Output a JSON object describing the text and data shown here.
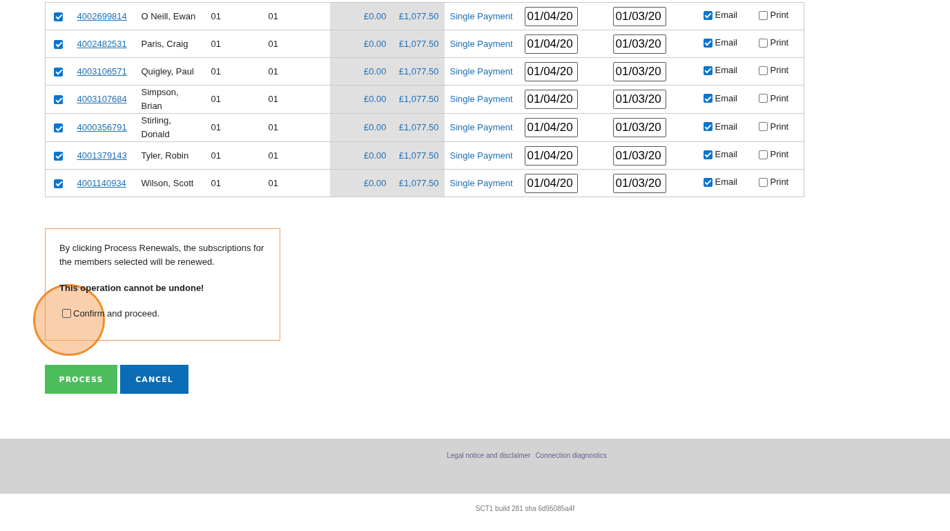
{
  "rows": [
    {
      "selected": true,
      "number": "4002699814",
      "name": "O Neill, Ewan",
      "column_4": "01",
      "column_5": "01",
      "column_6": "£0.00",
      "column_7": "£1,077.50",
      "payment": "Single Payment",
      "date_1": "01/04/20",
      "date_2": "01/03/20",
      "email": true,
      "email_label": "Email",
      "print": false,
      "print_label": "Print"
    },
    {
      "selected": true,
      "number": "4002482531",
      "name": "Paris, Craig",
      "column_4": "01",
      "column_5": "01",
      "column_6": "£0.00",
      "column_7": "£1,077.50",
      "payment": "Single Payment",
      "date_1": "01/04/20",
      "date_2": "01/03/20",
      "email": true,
      "email_label": "Email",
      "print": false,
      "print_label": "Print"
    },
    {
      "selected": true,
      "number": "4003106571",
      "name": "Quigley, Paul",
      "column_4": "01",
      "column_5": "01",
      "column_6": "£0.00",
      "column_7": "£1,077.50",
      "payment": "Single Payment",
      "date_1": "01/04/20",
      "date_2": "01/03/20",
      "email": true,
      "email_label": "Email",
      "print": false,
      "print_label": "Print"
    },
    {
      "selected": true,
      "number": "4003107684",
      "name": "Simpson, Brian",
      "column_4": "01",
      "column_5": "01",
      "column_6": "£0.00",
      "column_7": "£1,077.50",
      "payment": "Single Payment",
      "date_1": "01/04/20",
      "date_2": "01/03/20",
      "email": true,
      "email_label": "Email",
      "print": false,
      "print_label": "Print"
    },
    {
      "selected": true,
      "number": "4000356791",
      "name": "Stirling, Donald",
      "column_4": "01",
      "column_5": "01",
      "column_6": "£0.00",
      "column_7": "£1,077.50",
      "payment": "Single Payment",
      "date_1": "01/04/20",
      "date_2": "01/03/20",
      "email": true,
      "email_label": "Email",
      "print": false,
      "print_label": "Print"
    },
    {
      "selected": true,
      "number": "4001379143",
      "name": "Tyler, Robin",
      "column_4": "01",
      "column_5": "01",
      "column_6": "£0.00",
      "column_7": "£1,077.50",
      "payment": "Single Payment",
      "date_1": "01/04/20",
      "date_2": "01/03/20",
      "email": true,
      "email_label": "Email",
      "print": false,
      "print_label": "Print"
    },
    {
      "selected": true,
      "number": "4001140934",
      "name": "Wilson, Scott",
      "column_4": "01",
      "column_5": "01",
      "column_6": "£0.00",
      "column_7": "£1,077.50",
      "payment": "Single Payment",
      "date_1": "01/04/20",
      "date_2": "01/03/20",
      "email": true,
      "email_label": "Email",
      "print": false,
      "print_label": "Print"
    }
  ],
  "notice": {
    "text": "By clicking Process Renewals, the subscriptions for the members selected will be renewed.",
    "warning": "This operation cannot be undone!",
    "confirm_label": "Confirm and proceed.",
    "confirm_checked": false
  },
  "buttons": [
    "PROCESS",
    "CANCEL"
  ],
  "footer": {
    "links": [
      "Legal notice and disclaimer",
      "Connection diagnostics"
    ],
    "build": "SCT1 build 281 sha 6d95085a4f"
  }
}
